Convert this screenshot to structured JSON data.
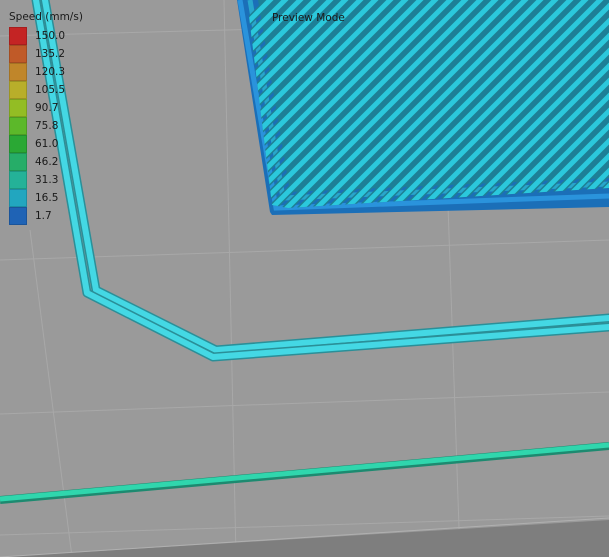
{
  "legend": {
    "title": "Speed (mm/s)",
    "items": [
      {
        "label": "150.0",
        "color": "#c42424"
      },
      {
        "label": "135.2",
        "color": "#c05a28"
      },
      {
        "label": "120.3",
        "color": "#c0862a"
      },
      {
        "label": "105.5",
        "color": "#b8ae2a"
      },
      {
        "label": "90.7",
        "color": "#93bd24"
      },
      {
        "label": "75.8",
        "color": "#5cb82a"
      },
      {
        "label": "61.0",
        "color": "#2aa834"
      },
      {
        "label": "46.2",
        "color": "#26ad68"
      },
      {
        "label": "31.3",
        "color": "#24b298"
      },
      {
        "label": "16.5",
        "color": "#22a6bf"
      },
      {
        "label": "1.7",
        "color": "#1f63b5"
      }
    ]
  },
  "view": {
    "mode_label": "Preview Mode",
    "background_color": "#9a9a9a",
    "travel_color": "#38d4e0",
    "perimeter_color": "#1f8fd6",
    "infill_color": "#2bc8dc",
    "skirt_color": "#28d0a8"
  }
}
